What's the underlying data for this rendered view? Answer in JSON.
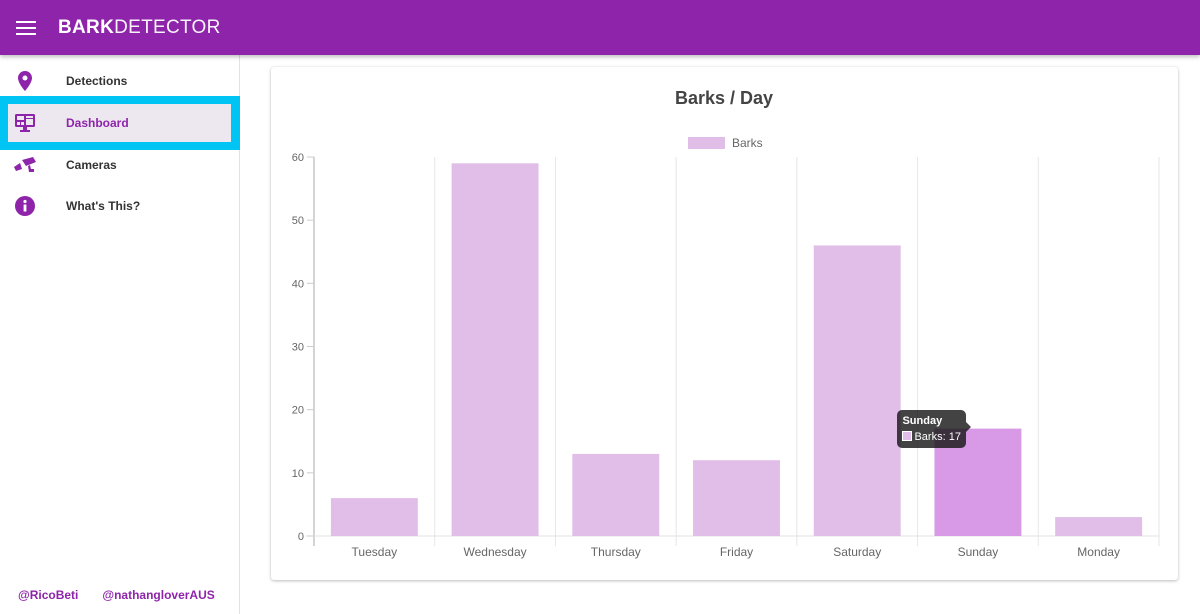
{
  "app": {
    "title_bold": "BARK",
    "title_light": "DETECTOR",
    "accent": "#8e24aa"
  },
  "sidebar": {
    "items": [
      {
        "label": "Detections",
        "icon": "map-marker-icon",
        "active": false
      },
      {
        "label": "Dashboard",
        "icon": "monitor-dashboard-icon",
        "active": true
      },
      {
        "label": "Cameras",
        "icon": "cctv-camera-icon",
        "active": false
      },
      {
        "label": "What's This?",
        "icon": "info-icon",
        "active": false
      }
    ],
    "footer_links": [
      "@RicoBeti",
      "@nathangloverAUS"
    ]
  },
  "chart_data": {
    "type": "bar",
    "title": "Barks / Day",
    "legend": [
      "Barks"
    ],
    "legend_position": "top",
    "categories": [
      "Tuesday",
      "Wednesday",
      "Thursday",
      "Friday",
      "Saturday",
      "Sunday",
      "Monday"
    ],
    "series": [
      {
        "name": "Barks",
        "values": [
          6,
          59,
          13,
          12,
          46,
          17,
          3
        ],
        "color": "#e1bee7",
        "hover_color": "#d899e6"
      }
    ],
    "ylim": [
      0,
      60
    ],
    "yticks": [
      0,
      10,
      20,
      30,
      40,
      50,
      60
    ],
    "xlabel": "",
    "ylabel": "",
    "grid": true,
    "tooltip": {
      "category": "Sunday",
      "label": "Barks: 17",
      "index": 5
    }
  }
}
